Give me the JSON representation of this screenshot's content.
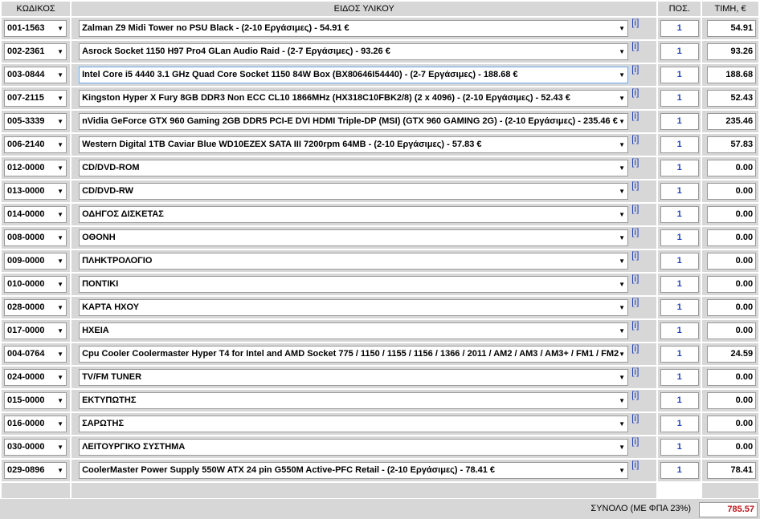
{
  "header": {
    "code": "ΚΩΔΙΚΟΣ",
    "item": "ΕΙΔΟΣ ΥΛΙΚΟΥ",
    "qty": "ΠΟΣ.",
    "price": "ΤΙΜΗ, €"
  },
  "info_label": "[i]",
  "rows": [
    {
      "code": "001-1563",
      "desc": "Zalman Z9 Midi Tower no PSU Black - (2-10 Εργάσιμες) - 54.91 €",
      "qty": "1",
      "price": "54.91"
    },
    {
      "code": "002-2361",
      "desc": "Asrock Socket 1150 H97 Pro4 GLan Audio Raid - (2-7 Εργάσιμες) - 93.26 €",
      "qty": "1",
      "price": "93.26"
    },
    {
      "code": "003-0844",
      "desc": "Intel Core i5 4440 3.1 GHz Quad Core Socket 1150 84W Box (BX80646I54440) - (2-7 Εργάσιμες) - 188.68 €",
      "qty": "1",
      "price": "188.68"
    },
    {
      "code": "007-2115",
      "desc": "Kingston Hyper X Fury 8GB DDR3 Non ECC CL10 1866MHz (HX318C10FBK2/8) (2 x 4096) - (2-10 Εργάσιμες) - 52.43 €",
      "qty": "1",
      "price": "52.43"
    },
    {
      "code": "005-3339",
      "desc": "nVidia GeForce GTX 960 Gaming 2GB DDR5 PCI-E DVI HDMI Triple-DP (MSI) (GTX 960 GAMING 2G) - (2-10 Εργάσιμες) - 235.46 €",
      "qty": "1",
      "price": "235.46"
    },
    {
      "code": "006-2140",
      "desc": "Western Digital 1TB Caviar Blue WD10EZEX SATA III 7200rpm 64MB - (2-10 Εργάσιμες) - 57.83 €",
      "qty": "1",
      "price": "57.83"
    },
    {
      "code": "012-0000",
      "desc": "CD/DVD-ROM",
      "qty": "1",
      "price": "0.00"
    },
    {
      "code": "013-0000",
      "desc": "CD/DVD-RW",
      "qty": "1",
      "price": "0.00"
    },
    {
      "code": "014-0000",
      "desc": "ΟΔΗΓΟΣ ΔΙΣΚΕΤΑΣ",
      "qty": "1",
      "price": "0.00"
    },
    {
      "code": "008-0000",
      "desc": "ΟΘΟΝΗ",
      "qty": "1",
      "price": "0.00"
    },
    {
      "code": "009-0000",
      "desc": "ΠΛΗΚΤΡΟΛΟΓΙΟ",
      "qty": "1",
      "price": "0.00"
    },
    {
      "code": "010-0000",
      "desc": "ΠΟΝΤΙΚΙ",
      "qty": "1",
      "price": "0.00"
    },
    {
      "code": "028-0000",
      "desc": "ΚΑΡΤΑ ΗΧΟΥ",
      "qty": "1",
      "price": "0.00"
    },
    {
      "code": "017-0000",
      "desc": "ΗΧΕΙΑ",
      "qty": "1",
      "price": "0.00"
    },
    {
      "code": "004-0764",
      "desc": "Cpu Cooler Coolermaster Hyper T4 for Intel and AMD Socket 775 / 1150 / 1155 / 1156 / 1366 / 2011 / AM2 / AM3 / AM3+ / FM1 / FM2",
      "qty": "1",
      "price": "24.59"
    },
    {
      "code": "024-0000",
      "desc": "TV/FM TUNER",
      "qty": "1",
      "price": "0.00"
    },
    {
      "code": "015-0000",
      "desc": "ΕΚΤΥΠΩΤΗΣ",
      "qty": "1",
      "price": "0.00"
    },
    {
      "code": "016-0000",
      "desc": "ΣΑΡΩΤΗΣ",
      "qty": "1",
      "price": "0.00"
    },
    {
      "code": "030-0000",
      "desc": "ΛΕΙΤΟΥΡΓΙΚΟ ΣΥΣΤΗΜΑ",
      "qty": "1",
      "price": "0.00"
    },
    {
      "code": "029-0896",
      "desc": "CoolerMaster Power Supply 550W ATX 24 pin G550M Active-PFC Retail - (2-10 Εργάσιμες) - 78.41 €",
      "qty": "1",
      "price": "78.41"
    }
  ],
  "total": {
    "label": "ΣΥΝΟΛΟ (ΜΕ ΦΠΑ 23%)",
    "value": "785.57"
  },
  "colors": {
    "info_link": "#1e3fbf",
    "qty_text": "#1e3fbf",
    "total_value": "#c0151b",
    "header_bg": "#d7d7d7"
  }
}
